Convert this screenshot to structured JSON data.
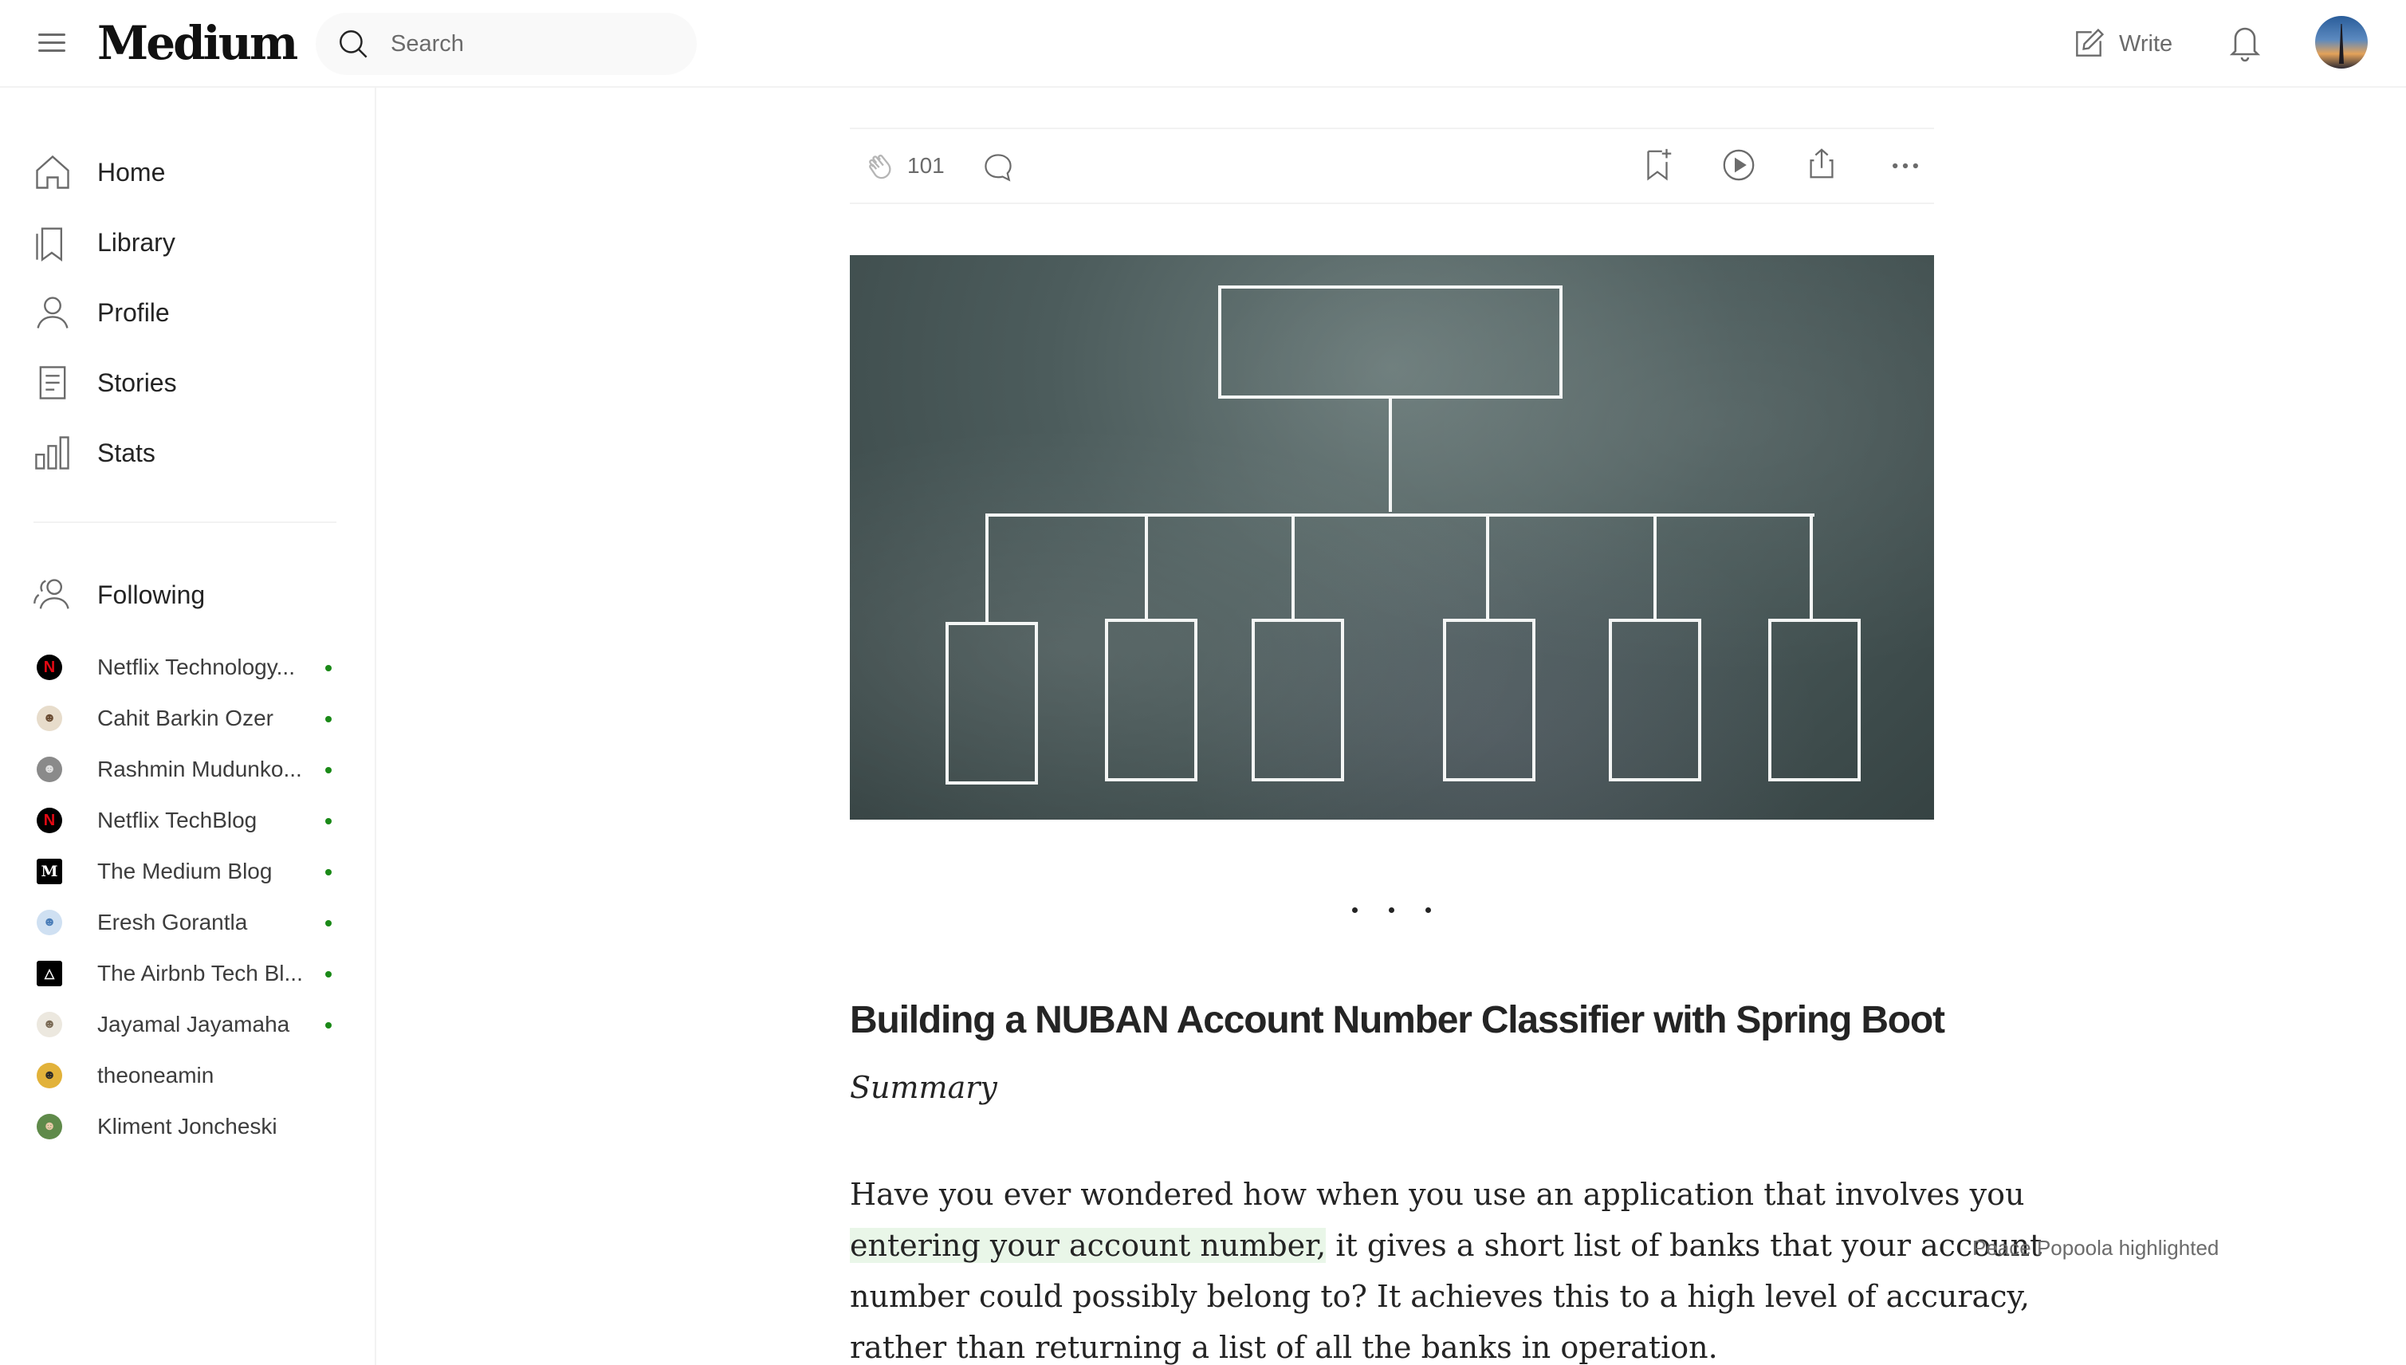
{
  "header": {
    "logo": "Medium",
    "search_placeholder": "Search",
    "write_label": "Write"
  },
  "sidebar": {
    "nav": [
      {
        "label": "Home",
        "icon": "home-icon"
      },
      {
        "label": "Library",
        "icon": "bookmark-icon"
      },
      {
        "label": "Profile",
        "icon": "user-icon"
      },
      {
        "label": "Stories",
        "icon": "document-icon"
      },
      {
        "label": "Stats",
        "icon": "chart-icon"
      }
    ],
    "following_label": "Following",
    "following": [
      {
        "name": "Netflix Technology...",
        "new": true,
        "color": "#000000"
      },
      {
        "name": "Cahit Barkin Ozer",
        "new": true,
        "color": "#d9c4a5"
      },
      {
        "name": "Rashmin Mudunko...",
        "new": true,
        "color": "#8a8a8a"
      },
      {
        "name": "Netflix TechBlog",
        "new": true,
        "color": "#000000"
      },
      {
        "name": "The Medium Blog",
        "new": true,
        "color": "#000000"
      },
      {
        "name": "Eresh Gorantla",
        "new": true,
        "color": "#4a7db8"
      },
      {
        "name": "The Airbnb Tech Bl...",
        "new": true,
        "color": "#000000"
      },
      {
        "name": "Jayamal Jayamaha",
        "new": true,
        "color": "#c8c0b0"
      },
      {
        "name": "theoneamin",
        "new": false,
        "color": "#e2b23a"
      },
      {
        "name": "Kliment Joncheski",
        "new": false,
        "color": "#5f8a4a"
      }
    ]
  },
  "article": {
    "clap_count": "101",
    "title": "Building a NUBAN Account Number Classifier with Spring Boot",
    "subtitle": "Summary",
    "paragraph_lines": [
      "Have you ever wondered how when you use an application that involves you",
      "entering your account number,",
      " it gives a short list of banks that your account",
      "number could possibly belong to? It achieves this to a high level of accuracy,",
      "rather than returning a list of all the banks in operation."
    ],
    "highlight_note": "Peace Popoola highlighted"
  },
  "colors": {
    "accent_green": "#1a8917",
    "text_primary": "#242424",
    "text_secondary": "#6b6b6b"
  }
}
